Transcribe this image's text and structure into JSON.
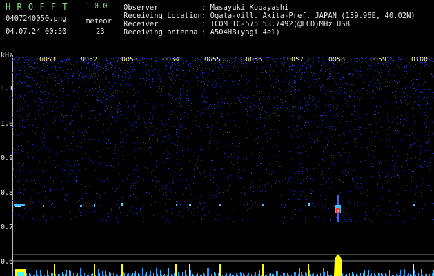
{
  "app": {
    "name": "H R O F F T",
    "version": "1.0.0"
  },
  "file_name": "0407240050.png",
  "timestamp": "04.07.24 00:50",
  "meteor": {
    "label": "meteor",
    "count": "23"
  },
  "info": {
    "observer_label": "Observer",
    "observer_value": ": Masayuki Kobayashi",
    "location_label": "Receiving Location",
    "location_value": ": Ogata-vill. Akita-Pref. JAPAN (139.96E, 40.02N)",
    "receiver_label": "Receiver",
    "receiver_value": ": ICOM IC-575 53.7492(@LCD)MHz USB",
    "antenna_label": "Receiving antenna",
    "antenna_value": ": A504HB(yagi 4el)"
  },
  "axis": {
    "unit": "kHz",
    "y_labels": [
      "1.1",
      "1.0",
      "0.9",
      "0.8",
      "0.7",
      "0.6"
    ],
    "time_ticks": [
      "0051",
      "0052",
      "0053",
      "0054",
      "0055",
      "0056",
      "0057",
      "0058",
      "0059",
      "0100"
    ]
  },
  "colors": {
    "background": "#000000",
    "text": "#e8e8e8",
    "title_green": "#7fe07f",
    "tick_yellow": "#f0f0a0",
    "noise_blue": "#2a2aa8",
    "echo_cyan": "#40c0ff",
    "echo_red": "#ff3030",
    "bar_yellow": "#ffff00"
  }
}
